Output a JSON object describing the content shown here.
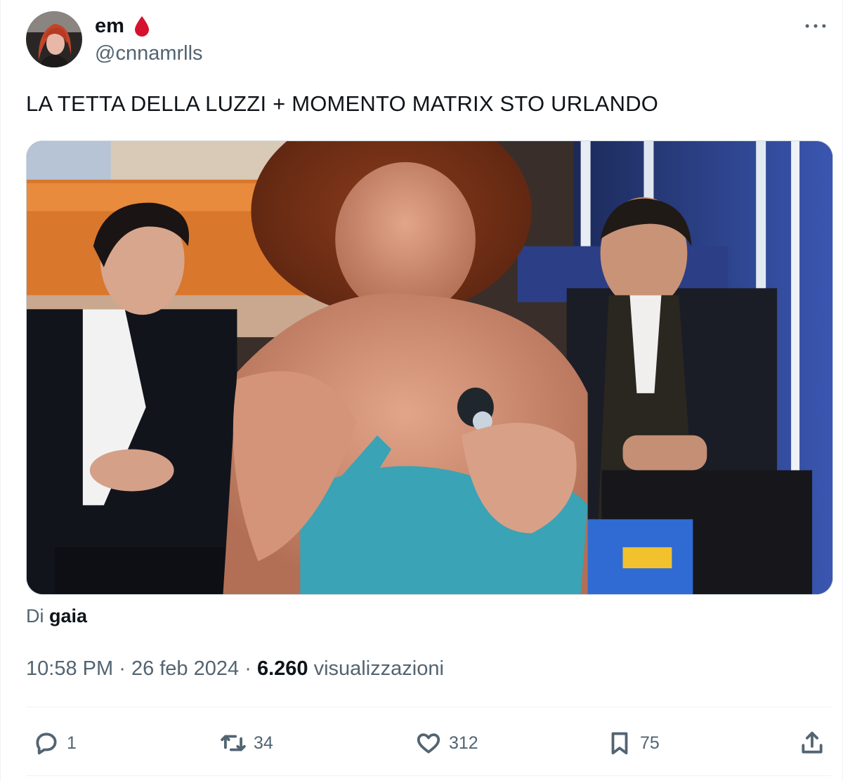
{
  "author": {
    "display_name": "em",
    "handle": "@cnnamrlls",
    "badge_icon": "blood-drop-icon",
    "badge_color": "#d6112e"
  },
  "tweet": {
    "text": "LA TETTA DELLA LUZZI + MOMENTO MATRIX STO URLANDO",
    "attribution_prefix": "Di",
    "attribution_name": "gaia",
    "time": "10:58 PM",
    "separator": "·",
    "date": "26 feb 2024",
    "views_count": "6.260",
    "views_label": "visualizzazioni"
  },
  "actions": {
    "reply": {
      "icon": "reply-icon",
      "count": "1"
    },
    "retweet": {
      "icon": "retweet-icon",
      "count": "34"
    },
    "like": {
      "icon": "heart-icon",
      "count": "312"
    },
    "bookmark": {
      "icon": "bookmark-icon",
      "count": "75"
    },
    "share": {
      "icon": "share-icon"
    }
  },
  "colors": {
    "text_primary": "#0f1419",
    "text_secondary": "#536471",
    "border": "#cfd9de"
  }
}
